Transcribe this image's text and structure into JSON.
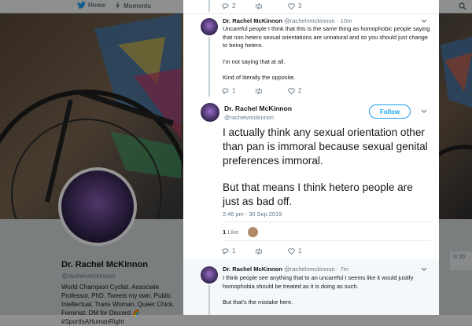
{
  "nav": {
    "home_label": "Home",
    "moments_label": "Moments"
  },
  "background_profile": {
    "name": "Dr. Rachel McKinnon",
    "handle": "@rachelvmckinnon",
    "bio": "World Champion Cyclist. Associate Professor, PhD. Tweets my own. Public Intellectual. Trans Woman. Queer Chick. Feminist. DM for Discord 🌈 #SportIsAHumanRight",
    "copyright": "© 20"
  },
  "top_actions": {
    "reply_count": "2",
    "retweet_count": "",
    "like_count": "3"
  },
  "tweet1": {
    "name": "Dr. Rachel McKinnon",
    "handle": "@rachelvmckinnon",
    "time": "· 10m",
    "p1": "Uncareful people I think that this is the same thing as homophobic people saying that non hetero sexual orientations are unnatural and so you should just change to being hetero.",
    "p2": "I'm not saying that at all.",
    "p3": "Kind of literally the opposite.",
    "reply_count": "1",
    "retweet_count": "",
    "like_count": "2"
  },
  "main_tweet": {
    "name": "Dr. Rachel McKinnon",
    "handle": "@rachelvmckinnon",
    "follow_label": "Follow",
    "p1": "I actually think any sexual orientation other than pan is immoral because sexual genital preferences immoral.",
    "p2": "But that means I think hetero people are just as bad off.",
    "timestamp": "2:46 pm - 30 Sep 2019",
    "likes_number": "1",
    "likes_word": "Like",
    "reply_count": "1",
    "retweet_count": "",
    "like_count": "1"
  },
  "tweet3": {
    "name": "Dr. Rachel McKinnon",
    "handle": "@rachelvmckinnon",
    "time": "· 7m",
    "p1": "I think people see anything that to an uncareful I seems like it would justify homophobia should be treated as it is doing as such.",
    "p2": "But that's the mistake here."
  },
  "colors": {
    "accent": "#1da1f2",
    "text": "#14171a",
    "muted": "#657786"
  }
}
